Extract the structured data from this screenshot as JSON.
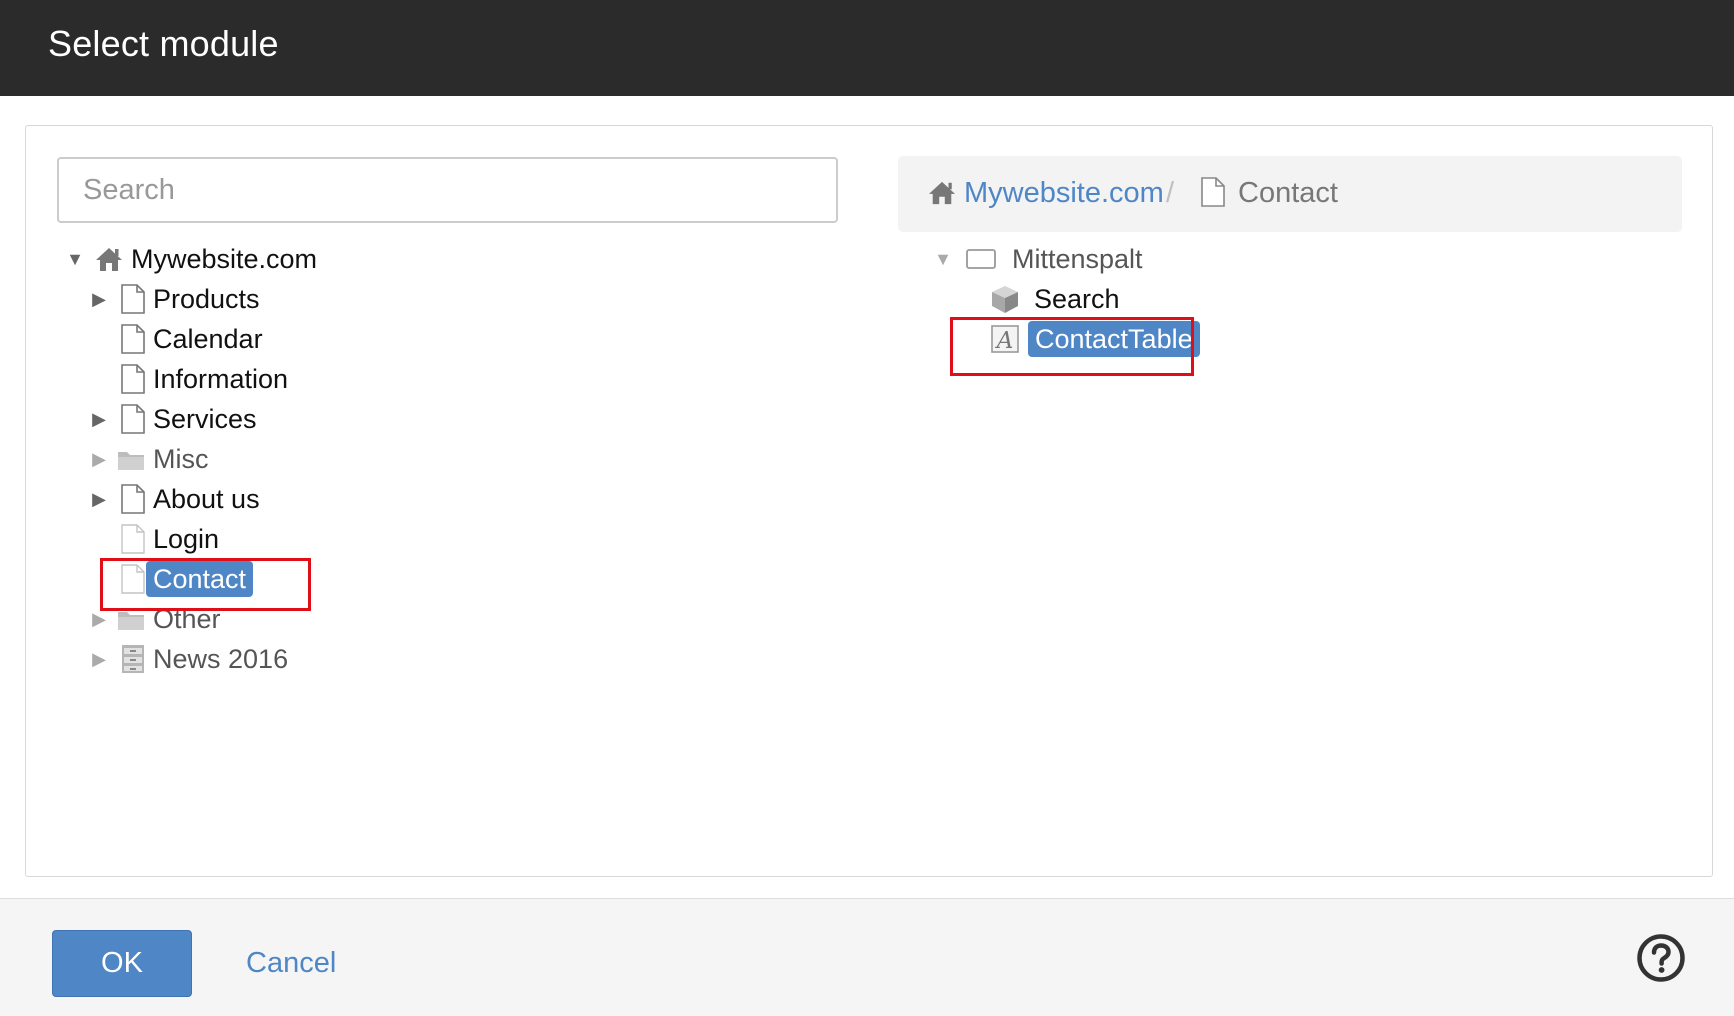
{
  "dialog": {
    "title": "Select module"
  },
  "search": {
    "placeholder": "Search"
  },
  "left_tree": {
    "root": {
      "label": "Mywebsite.com"
    },
    "items": [
      {
        "label": "Products",
        "icon": "page-icon",
        "expandable": true
      },
      {
        "label": "Calendar",
        "icon": "page-icon",
        "expandable": false
      },
      {
        "label": "Information",
        "icon": "page-icon",
        "expandable": false
      },
      {
        "label": "Services",
        "icon": "page-icon",
        "expandable": true
      },
      {
        "label": "Misc",
        "icon": "folder-icon",
        "expandable": true
      },
      {
        "label": "About us",
        "icon": "page-icon",
        "expandable": true
      },
      {
        "label": "Login",
        "icon": "page-icon",
        "expandable": false
      },
      {
        "label": "Contact",
        "icon": "page-icon",
        "expandable": false,
        "selected": true
      },
      {
        "label": "Other",
        "icon": "folder-icon",
        "expandable": true
      },
      {
        "label": "News 2016",
        "icon": "cabinet-icon",
        "expandable": true
      }
    ]
  },
  "breadcrumb": {
    "home": "Mywebsite.com",
    "separator": "/",
    "current": "Contact"
  },
  "right_tree": {
    "container": {
      "label": "Mittenspalt"
    },
    "items": [
      {
        "label": "Search",
        "icon": "cube-icon"
      },
      {
        "label": "ContactTable",
        "icon": "text-module-icon",
        "selected": true
      }
    ]
  },
  "footer": {
    "ok_label": "OK",
    "cancel_label": "Cancel"
  },
  "colors": {
    "accent": "#4f86c6",
    "titlebar": "#2b2b2b",
    "highlight": "#e00e16"
  }
}
